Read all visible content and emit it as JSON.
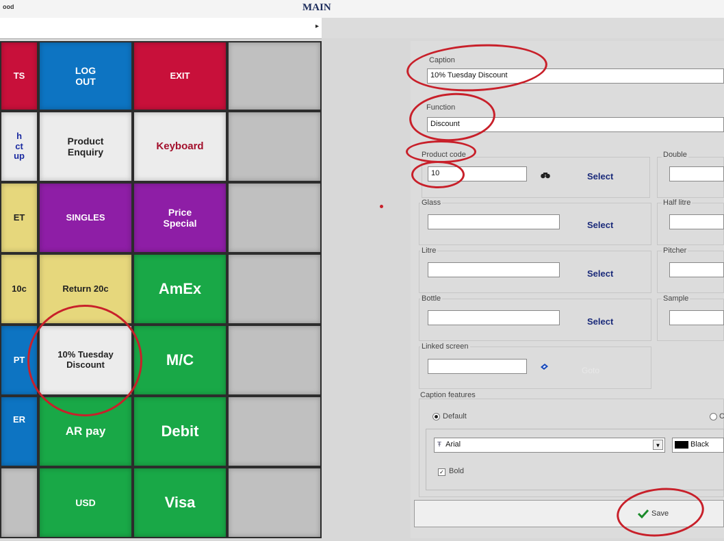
{
  "window": {
    "app_title": "ood",
    "title": "MAIN"
  },
  "toolbar": {
    "arrow": "▸"
  },
  "tiles": {
    "r1c1": "TS",
    "r1c2": "LOG\nOUT",
    "r1c3": "EXIT",
    "r2c1": "h\nct\nup",
    "r2c2": "Product\nEnquiry",
    "r2c3": "Keyboard",
    "r3c1": "ET",
    "r3c2": "SINGLES",
    "r3c3": "Price\nSpecial",
    "r4c1": "10c",
    "r4c2": "Return 20c",
    "r4c3": "AmEx",
    "r5c1": "PT",
    "r5c2": "10% Tuesday\nDiscount",
    "r5c3": "M/C",
    "r6c1": "ER",
    "r6c2": "AR pay",
    "r6c3": "Debit",
    "r7c2": "USD",
    "r7c3": "Visa"
  },
  "form": {
    "caption_label": "Caption",
    "caption_value": "10% Tuesday Discount",
    "function_label": "Function",
    "function_value": "Discount",
    "product_code_label": "Product code",
    "product_code_value": "10",
    "double_label": "Double",
    "glass_label": "Glass",
    "half_litre_label": "Half litre",
    "litre_label": "Litre",
    "pitcher_label": "Pitcher",
    "bottle_label": "Bottle",
    "sample_label": "Sample",
    "linked_screen_label": "Linked screen",
    "goto_label": "Goto",
    "select_label": "Select",
    "caption_features_label": "Caption features",
    "default_label": "Default",
    "other_label": "C",
    "font_value": "Arial",
    "color_value": "Black",
    "bold_label": "Bold",
    "save_label": "Save"
  },
  "icons": {
    "binoculars": "binoculars-icon",
    "link": "link-icon",
    "save_check": "check-icon",
    "font": "font-icon"
  },
  "colors": {
    "red": "#c8103a",
    "blue": "#0d74c2",
    "green": "#19a847",
    "purple": "#8e1ea6",
    "yellow": "#e6d77c",
    "annotation": "#c8202a"
  }
}
